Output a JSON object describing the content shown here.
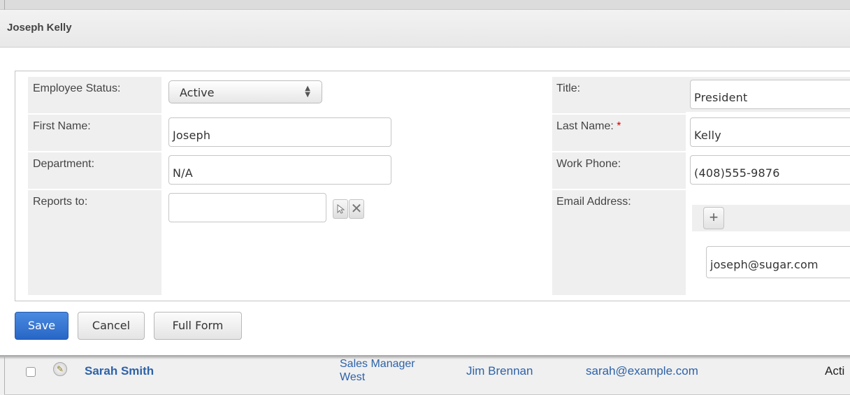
{
  "record_title": "Joseph Kelly",
  "form": {
    "employee_status": {
      "label": "Employee Status:",
      "value": "Active"
    },
    "first_name": {
      "label": "First Name:",
      "value": "Joseph"
    },
    "department": {
      "label": "Department:",
      "value": "N/A"
    },
    "reports_to": {
      "label": "Reports to:",
      "value": ""
    },
    "title": {
      "label": "Title:",
      "value": "President"
    },
    "last_name": {
      "label": "Last Name:",
      "required_mark": "*",
      "value": "Kelly"
    },
    "work_phone": {
      "label": "Work Phone:",
      "value": "(408)555-9876"
    },
    "email_address": {
      "label": "Email Address:",
      "value": "joseph@sugar.com"
    }
  },
  "icons": {
    "select_arrows": "select-arrows-icon",
    "select_record": "cursor-arrow-icon",
    "clear": "close-icon",
    "add": "plus-icon",
    "edit": "pencil-icon"
  },
  "buttons": {
    "save": "Save",
    "cancel": "Cancel",
    "full_form": "Full Form"
  },
  "list_row": {
    "name": "Sarah Smith",
    "title_line1": "Sales Manager",
    "title_line2": "West",
    "reports_to": "Jim Brennan",
    "email": "sarah@example.com",
    "status": "Acti"
  },
  "colors": {
    "primary_button": "#2866c6",
    "link": "#2d62a8",
    "required": "#d30000",
    "label_bg": "#efefef"
  }
}
